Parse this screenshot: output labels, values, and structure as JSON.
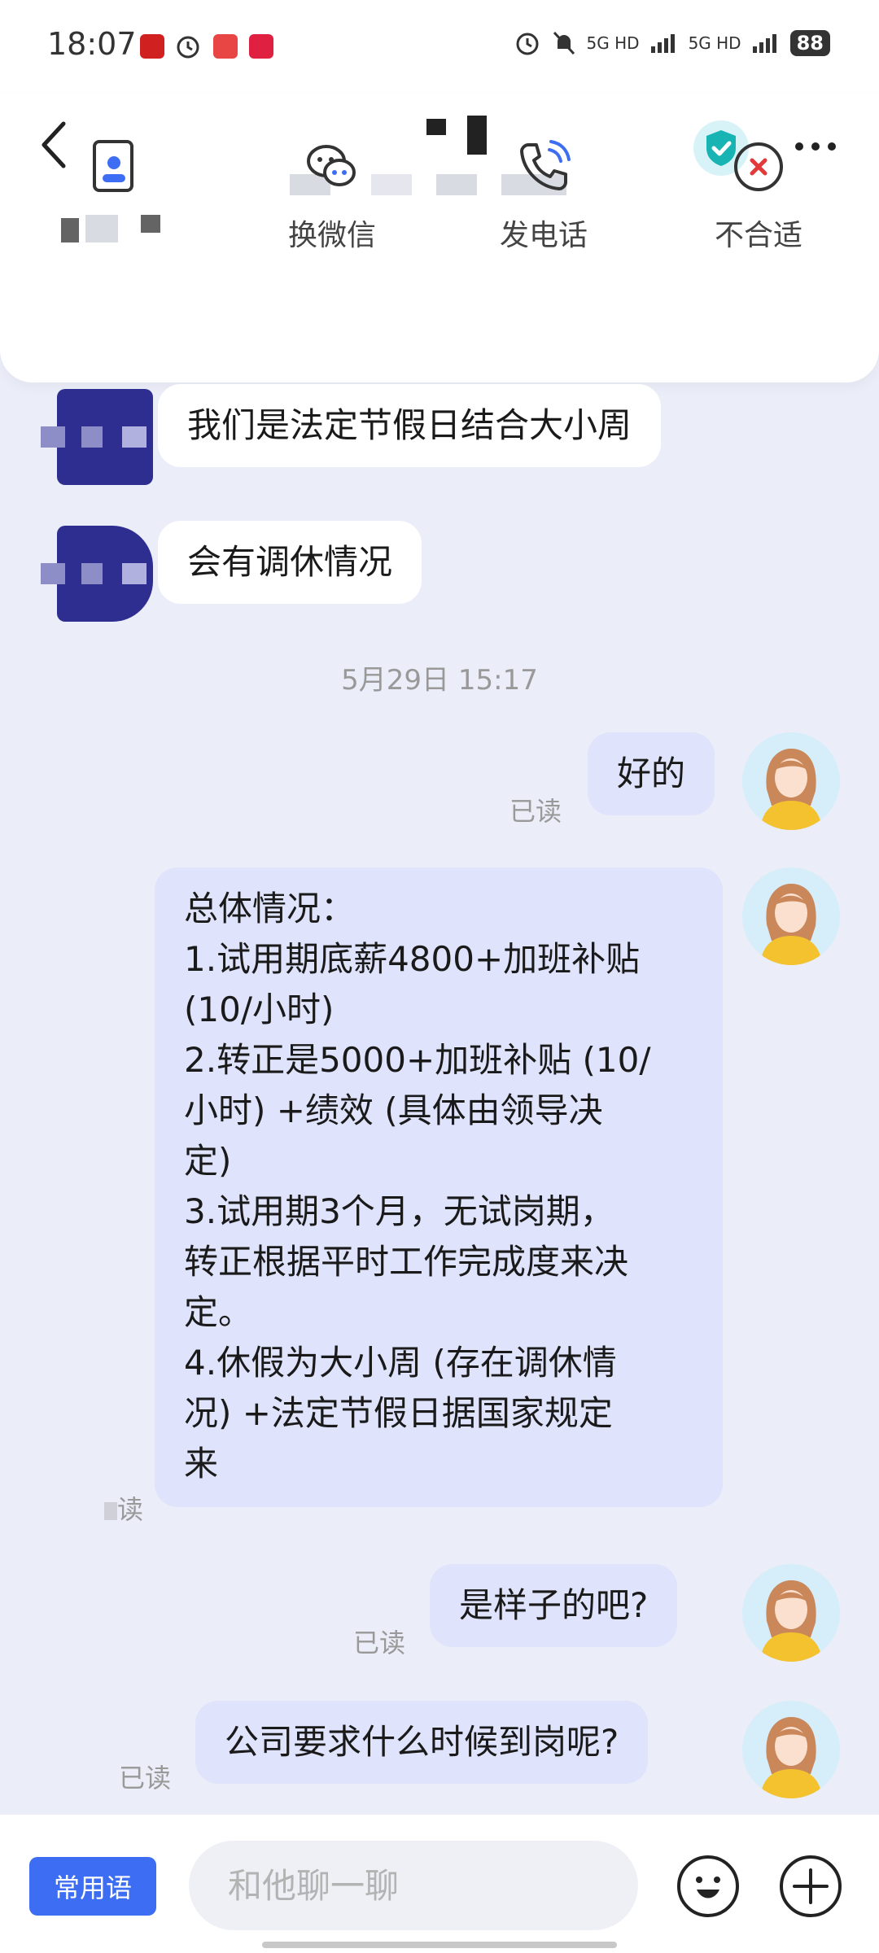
{
  "status_bar": {
    "time": "18:07",
    "network_1": "5G HD",
    "network_2": "5G HD",
    "battery": "88"
  },
  "header": {
    "actions": [
      {
        "label": "换微信",
        "icon": "wechat-icon"
      },
      {
        "label": "发电话",
        "icon": "phone-icon"
      },
      {
        "label": "不合适",
        "icon": "close-circle-icon"
      }
    ]
  },
  "messages": [
    {
      "side": "in",
      "text": "我们是法定节假日结合大小周"
    },
    {
      "side": "in",
      "text": "会有调休情况"
    },
    {
      "timestamp": "5月29日 15:17"
    },
    {
      "side": "out",
      "text": "好的",
      "status": "已读"
    },
    {
      "side": "out",
      "lines": [
        "总体情况：",
        "1.试用期底薪4800+加班补贴",
        "(10/小时)",
        "2.转正是5000+加班补贴 (10/",
        "小时) +绩效 (具体由领导决",
        "定)",
        "3.试用期3个月，无试岗期，",
        "转正根据平时工作完成度来决",
        "定。",
        "4.休假为大小周 (存在调休情",
        "况) +法定节假日据国家规定",
        "来"
      ],
      "status": "读"
    },
    {
      "side": "out",
      "text": "是样子的吧?",
      "status": "已读"
    },
    {
      "side": "out",
      "text": "公司要求什么时候到岗呢?",
      "status": "已读"
    }
  ],
  "input_bar": {
    "phrase_button": "常用语",
    "placeholder": "和他聊一聊"
  },
  "colors": {
    "accent": "#3d6df2",
    "bubble_out": "#dfe3fb",
    "bubble_in": "#ffffff",
    "background": "#ebeef8"
  }
}
